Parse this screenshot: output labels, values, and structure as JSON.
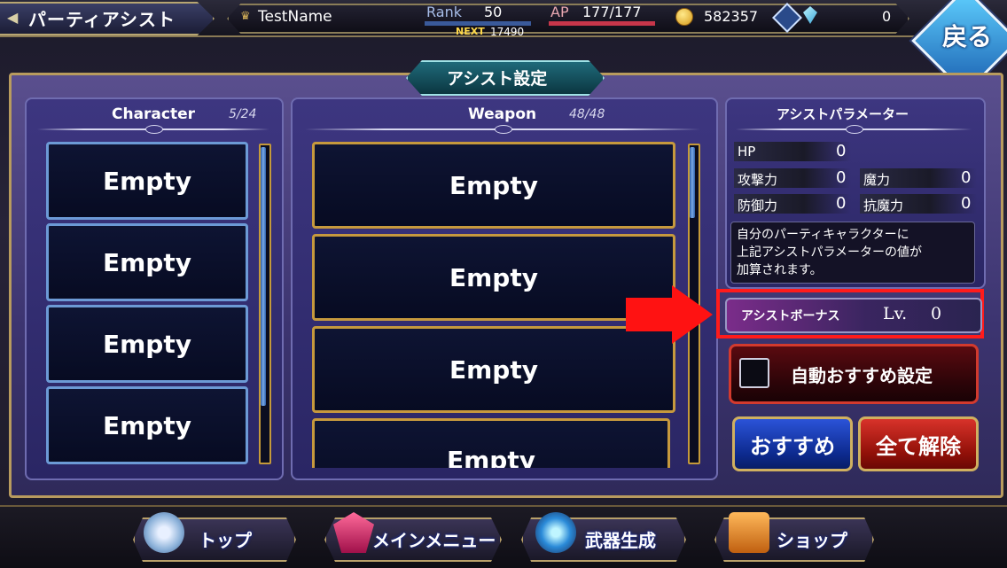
{
  "header": {
    "screen_title": "パーティアシスト",
    "player_name": "TestName",
    "rank_label": "Rank",
    "rank_value": "50",
    "next_label": "NEXT",
    "next_value": "17490",
    "ap_label": "AP",
    "ap_value": "177/177",
    "gold": "582357",
    "gems": "0",
    "back_label": "戻る",
    "icons": [
      "arrow-left-icon",
      "crown-icon",
      "coin-icon",
      "cross-icon",
      "crystal-icon"
    ]
  },
  "main": {
    "section_title": "アシスト設定",
    "character_panel": {
      "title": "Character",
      "count": "5/24",
      "slots": [
        "Empty",
        "Empty",
        "Empty",
        "Empty"
      ]
    },
    "weapon_panel": {
      "title": "Weapon",
      "count": "48/48",
      "slots": [
        "Empty",
        "Empty",
        "Empty",
        "Empty"
      ]
    },
    "params_panel": {
      "title": "アシストパラメーター",
      "hp_label": "HP",
      "hp_value": "0",
      "atk_label": "攻撃力",
      "atk_value": "0",
      "mag_label": "魔力",
      "mag_value": "0",
      "def_label": "防御力",
      "def_value": "0",
      "res_label": "抗魔力",
      "res_value": "0",
      "description": "自分のパーティキャラクターに\n上記アシストパラメーターの値が\n加算されます。",
      "bonus_label": "アシストボーナス",
      "bonus_lv_label": "Lv.",
      "bonus_lv_value": "0",
      "auto_recommend_label": "自動おすすめ設定",
      "recommend_button": "おすすめ",
      "clear_all_button": "全て解除"
    }
  },
  "bottom_nav": {
    "top": "トップ",
    "main_menu": "メインメニュー",
    "weapon_craft": "武器生成",
    "shop": "ショップ"
  },
  "colors": {
    "highlight": "#ff1b1b",
    "panel_bg": "#3d3680",
    "frame_gold": "#b89b5e"
  }
}
